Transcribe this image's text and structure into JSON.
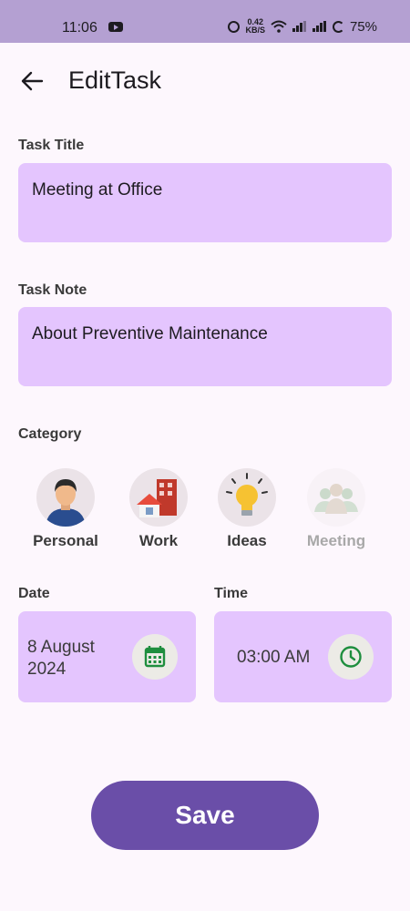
{
  "status_bar": {
    "time": "11:06",
    "net_speed_value": "0.42",
    "net_speed_unit": "KB/S",
    "battery": "75%"
  },
  "header": {
    "title": "EditTask"
  },
  "task_title": {
    "label": "Task Title",
    "value": "Meeting at Office"
  },
  "task_note": {
    "label": "Task Note",
    "value": "About Preventive Maintenance"
  },
  "category": {
    "label": "Category",
    "items": [
      {
        "label": "Personal",
        "icon": "person-icon",
        "selected": true
      },
      {
        "label": "Work",
        "icon": "building-icon",
        "selected": true
      },
      {
        "label": "Ideas",
        "icon": "lightbulb-icon",
        "selected": true
      },
      {
        "label": "Meeting",
        "icon": "group-icon",
        "selected": false
      }
    ]
  },
  "date": {
    "label": "Date",
    "value": "8 August 2024",
    "icon": "calendar-icon",
    "icon_color": "#1e8e3e"
  },
  "time": {
    "label": "Time",
    "value": "03:00 AM",
    "icon": "clock-icon",
    "icon_color": "#1e8e3e"
  },
  "save_button": {
    "label": "Save",
    "color": "#6a4ea8"
  },
  "colors": {
    "status_bar": "#b4a0d2",
    "field_bg": "#e4c5fe",
    "page_bg": "#fdf7fd"
  }
}
